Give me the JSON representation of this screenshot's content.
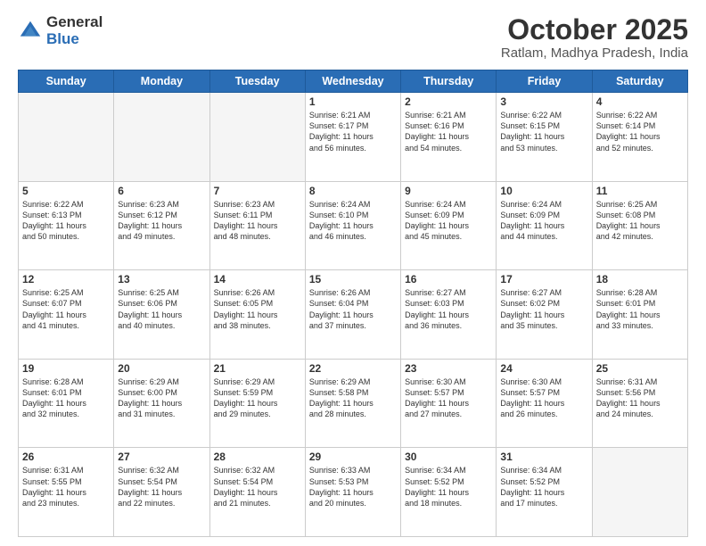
{
  "header": {
    "logo_general": "General",
    "logo_blue": "Blue",
    "month_title": "October 2025",
    "location": "Ratlam, Madhya Pradesh, India"
  },
  "weekdays": [
    "Sunday",
    "Monday",
    "Tuesday",
    "Wednesday",
    "Thursday",
    "Friday",
    "Saturday"
  ],
  "weeks": [
    [
      {
        "day": "",
        "info": ""
      },
      {
        "day": "",
        "info": ""
      },
      {
        "day": "",
        "info": ""
      },
      {
        "day": "1",
        "info": "Sunrise: 6:21 AM\nSunset: 6:17 PM\nDaylight: 11 hours\nand 56 minutes."
      },
      {
        "day": "2",
        "info": "Sunrise: 6:21 AM\nSunset: 6:16 PM\nDaylight: 11 hours\nand 54 minutes."
      },
      {
        "day": "3",
        "info": "Sunrise: 6:22 AM\nSunset: 6:15 PM\nDaylight: 11 hours\nand 53 minutes."
      },
      {
        "day": "4",
        "info": "Sunrise: 6:22 AM\nSunset: 6:14 PM\nDaylight: 11 hours\nand 52 minutes."
      }
    ],
    [
      {
        "day": "5",
        "info": "Sunrise: 6:22 AM\nSunset: 6:13 PM\nDaylight: 11 hours\nand 50 minutes."
      },
      {
        "day": "6",
        "info": "Sunrise: 6:23 AM\nSunset: 6:12 PM\nDaylight: 11 hours\nand 49 minutes."
      },
      {
        "day": "7",
        "info": "Sunrise: 6:23 AM\nSunset: 6:11 PM\nDaylight: 11 hours\nand 48 minutes."
      },
      {
        "day": "8",
        "info": "Sunrise: 6:24 AM\nSunset: 6:10 PM\nDaylight: 11 hours\nand 46 minutes."
      },
      {
        "day": "9",
        "info": "Sunrise: 6:24 AM\nSunset: 6:09 PM\nDaylight: 11 hours\nand 45 minutes."
      },
      {
        "day": "10",
        "info": "Sunrise: 6:24 AM\nSunset: 6:09 PM\nDaylight: 11 hours\nand 44 minutes."
      },
      {
        "day": "11",
        "info": "Sunrise: 6:25 AM\nSunset: 6:08 PM\nDaylight: 11 hours\nand 42 minutes."
      }
    ],
    [
      {
        "day": "12",
        "info": "Sunrise: 6:25 AM\nSunset: 6:07 PM\nDaylight: 11 hours\nand 41 minutes."
      },
      {
        "day": "13",
        "info": "Sunrise: 6:25 AM\nSunset: 6:06 PM\nDaylight: 11 hours\nand 40 minutes."
      },
      {
        "day": "14",
        "info": "Sunrise: 6:26 AM\nSunset: 6:05 PM\nDaylight: 11 hours\nand 38 minutes."
      },
      {
        "day": "15",
        "info": "Sunrise: 6:26 AM\nSunset: 6:04 PM\nDaylight: 11 hours\nand 37 minutes."
      },
      {
        "day": "16",
        "info": "Sunrise: 6:27 AM\nSunset: 6:03 PM\nDaylight: 11 hours\nand 36 minutes."
      },
      {
        "day": "17",
        "info": "Sunrise: 6:27 AM\nSunset: 6:02 PM\nDaylight: 11 hours\nand 35 minutes."
      },
      {
        "day": "18",
        "info": "Sunrise: 6:28 AM\nSunset: 6:01 PM\nDaylight: 11 hours\nand 33 minutes."
      }
    ],
    [
      {
        "day": "19",
        "info": "Sunrise: 6:28 AM\nSunset: 6:01 PM\nDaylight: 11 hours\nand 32 minutes."
      },
      {
        "day": "20",
        "info": "Sunrise: 6:29 AM\nSunset: 6:00 PM\nDaylight: 11 hours\nand 31 minutes."
      },
      {
        "day": "21",
        "info": "Sunrise: 6:29 AM\nSunset: 5:59 PM\nDaylight: 11 hours\nand 29 minutes."
      },
      {
        "day": "22",
        "info": "Sunrise: 6:29 AM\nSunset: 5:58 PM\nDaylight: 11 hours\nand 28 minutes."
      },
      {
        "day": "23",
        "info": "Sunrise: 6:30 AM\nSunset: 5:57 PM\nDaylight: 11 hours\nand 27 minutes."
      },
      {
        "day": "24",
        "info": "Sunrise: 6:30 AM\nSunset: 5:57 PM\nDaylight: 11 hours\nand 26 minutes."
      },
      {
        "day": "25",
        "info": "Sunrise: 6:31 AM\nSunset: 5:56 PM\nDaylight: 11 hours\nand 24 minutes."
      }
    ],
    [
      {
        "day": "26",
        "info": "Sunrise: 6:31 AM\nSunset: 5:55 PM\nDaylight: 11 hours\nand 23 minutes."
      },
      {
        "day": "27",
        "info": "Sunrise: 6:32 AM\nSunset: 5:54 PM\nDaylight: 11 hours\nand 22 minutes."
      },
      {
        "day": "28",
        "info": "Sunrise: 6:32 AM\nSunset: 5:54 PM\nDaylight: 11 hours\nand 21 minutes."
      },
      {
        "day": "29",
        "info": "Sunrise: 6:33 AM\nSunset: 5:53 PM\nDaylight: 11 hours\nand 20 minutes."
      },
      {
        "day": "30",
        "info": "Sunrise: 6:34 AM\nSunset: 5:52 PM\nDaylight: 11 hours\nand 18 minutes."
      },
      {
        "day": "31",
        "info": "Sunrise: 6:34 AM\nSunset: 5:52 PM\nDaylight: 11 hours\nand 17 minutes."
      },
      {
        "day": "",
        "info": ""
      }
    ]
  ]
}
